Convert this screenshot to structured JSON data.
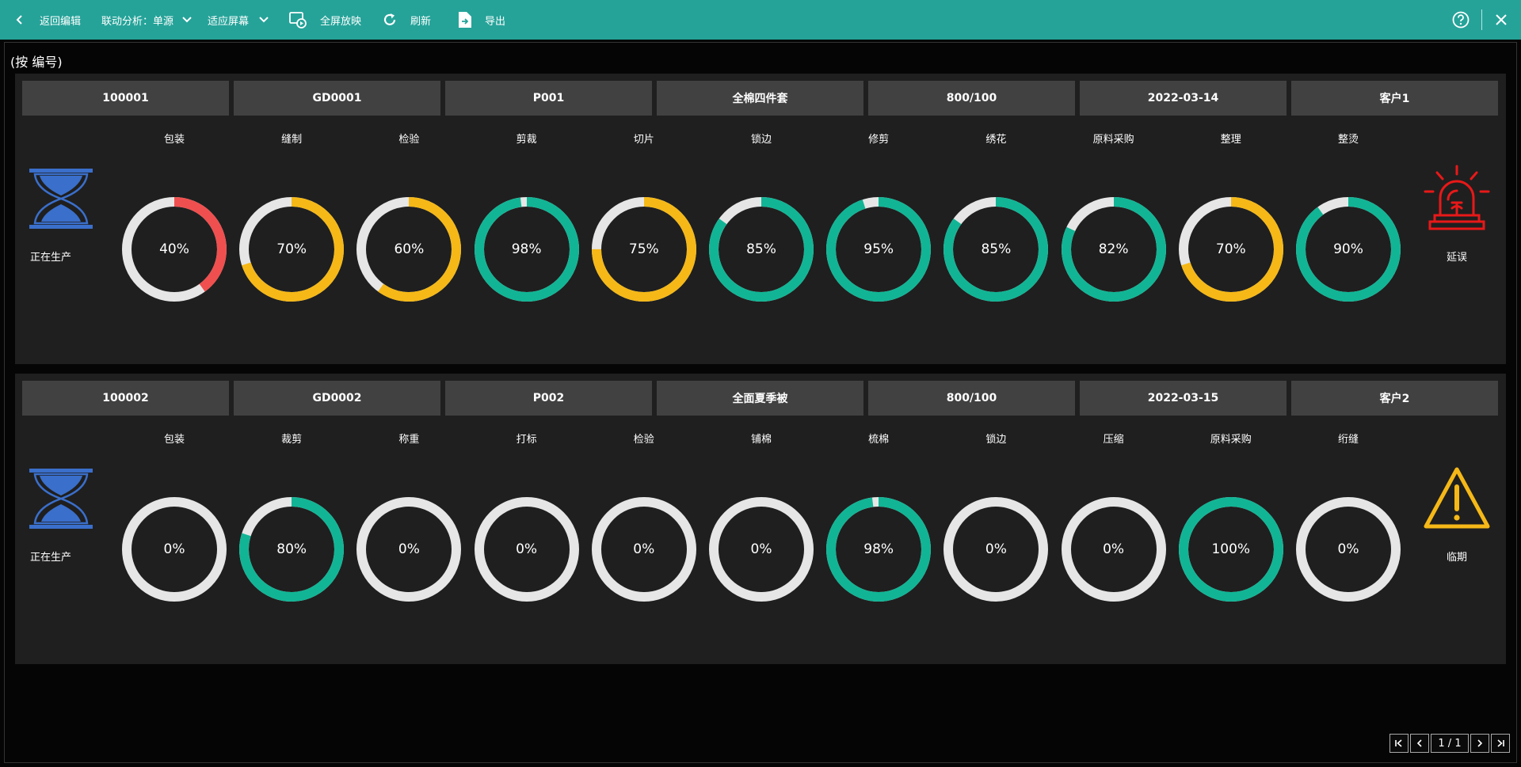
{
  "toolbar": {
    "back_label": "返回编辑",
    "linkage_label": "联动分析：单源",
    "fit_label": "适应屏幕",
    "fullscreen_label": "全屏放映",
    "refresh_label": "刷新",
    "export_label": "导出"
  },
  "page": {
    "title": "(按 编号)"
  },
  "colors": {
    "teal": "#11b595",
    "yellow": "#f5b817",
    "red": "#f04f4f",
    "track": "#e6e6e6",
    "hourglass": "#3a6fcb",
    "alarm": "#e81818",
    "warning": "#f5b817"
  },
  "rows": [
    {
      "cells": [
        "100001",
        "GD0001",
        "P001",
        "全棉四件套",
        "800/100",
        "2022-03-14",
        "客户1"
      ],
      "status_left": {
        "icon": "hourglass-icon",
        "text": "正在生产"
      },
      "status_right": {
        "icon": "alarm-icon",
        "text": "延误"
      },
      "processes": [
        {
          "name": "包装",
          "value": 40,
          "label": "40%",
          "color": "#f04f4f"
        },
        {
          "name": "缝制",
          "value": 70,
          "label": "70%",
          "color": "#f5b817"
        },
        {
          "name": "检验",
          "value": 60,
          "label": "60%",
          "color": "#f5b817"
        },
        {
          "name": "剪裁",
          "value": 98,
          "label": "98%",
          "color": "#11b595"
        },
        {
          "name": "切片",
          "value": 75,
          "label": "75%",
          "color": "#f5b817"
        },
        {
          "name": "锁边",
          "value": 85,
          "label": "85%",
          "color": "#11b595"
        },
        {
          "name": "修剪",
          "value": 95,
          "label": "95%",
          "color": "#11b595"
        },
        {
          "name": "绣花",
          "value": 85,
          "label": "85%",
          "color": "#11b595"
        },
        {
          "name": "原料采购",
          "value": 82,
          "label": "82%",
          "color": "#11b595"
        },
        {
          "name": "整理",
          "value": 70,
          "label": "70%",
          "color": "#f5b817"
        },
        {
          "name": "整烫",
          "value": 90,
          "label": "90%",
          "color": "#11b595"
        }
      ]
    },
    {
      "cells": [
        "100002",
        "GD0002",
        "P002",
        "全面夏季被",
        "800/100",
        "2022-03-15",
        "客户2"
      ],
      "status_left": {
        "icon": "hourglass-icon",
        "text": "正在生产"
      },
      "status_right": {
        "icon": "warning-icon",
        "text": "临期"
      },
      "processes": [
        {
          "name": "包装",
          "value": 0,
          "label": "0%",
          "color": "#11b595"
        },
        {
          "name": "裁剪",
          "value": 80,
          "label": "80%",
          "color": "#11b595"
        },
        {
          "name": "称重",
          "value": 0,
          "label": "0%",
          "color": "#11b595"
        },
        {
          "name": "打标",
          "value": 0,
          "label": "0%",
          "color": "#11b595"
        },
        {
          "name": "检验",
          "value": 0,
          "label": "0%",
          "color": "#11b595"
        },
        {
          "name": "铺棉",
          "value": 0,
          "label": "0%",
          "color": "#11b595"
        },
        {
          "name": "梳棉",
          "value": 98,
          "label": "98%",
          "color": "#11b595"
        },
        {
          "name": "锁边",
          "value": 0,
          "label": "0%",
          "color": "#11b595"
        },
        {
          "name": "压缩",
          "value": 0,
          "label": "0%",
          "color": "#11b595"
        },
        {
          "name": "原料采购",
          "value": 100,
          "label": "100%",
          "color": "#11b595"
        },
        {
          "name": "绗缝",
          "value": 0,
          "label": "0%",
          "color": "#11b595"
        }
      ]
    }
  ],
  "pager": {
    "first": "⏮",
    "prev": "‹",
    "page_text": "1 / 1",
    "next": "›",
    "last": "⏭"
  }
}
